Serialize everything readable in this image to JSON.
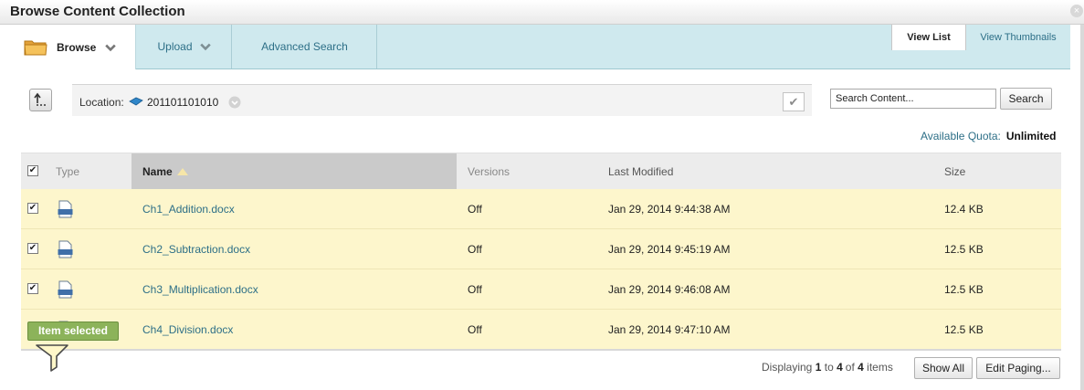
{
  "window": {
    "title": "Browse Content Collection",
    "close_glyph": "×"
  },
  "tabs": {
    "browse": "Browse",
    "upload": "Upload",
    "advanced_search": "Advanced Search",
    "view_list": "View List",
    "view_thumbnails": "View Thumbnails"
  },
  "location": {
    "label": "Location:",
    "value": "201101101010",
    "check_glyph": "✔"
  },
  "search": {
    "placeholder": "Search Content...",
    "value": "Search Content...",
    "button": "Search"
  },
  "quota": {
    "label": "Available Quota:",
    "value": "Unlimited"
  },
  "table": {
    "headers": {
      "type": "Type",
      "name": "Name",
      "versions": "Versions",
      "last_modified": "Last Modified",
      "size": "Size"
    },
    "rows": [
      {
        "name": "Ch1_Addition.docx",
        "versions": "Off",
        "modified": "Jan 29, 2014 9:44:38 AM",
        "size": "12.4 KB",
        "checked": true
      },
      {
        "name": "Ch2_Subtraction.docx",
        "versions": "Off",
        "modified": "Jan 29, 2014 9:45:19 AM",
        "size": "12.5 KB",
        "checked": true
      },
      {
        "name": "Ch3_Multiplication.docx",
        "versions": "Off",
        "modified": "Jan 29, 2014 9:46:08 AM",
        "size": "12.5 KB",
        "checked": true
      },
      {
        "name": "Ch4_Division.docx",
        "versions": "Off",
        "modified": "Jan 29, 2014 9:47:10 AM",
        "size": "12.5 KB",
        "checked": true
      }
    ],
    "check_glyph": "✔"
  },
  "tooltip": {
    "text": "Item selected"
  },
  "paging": {
    "prefix": "Displaying",
    "from": "1",
    "to_word": "to",
    "to": "4",
    "of_word": "of",
    "total": "4",
    "suffix": "items",
    "show_all": "Show All",
    "edit_paging": "Edit Paging..."
  },
  "colors": {
    "accent_link": "#2d6f87",
    "tab_bar": "#cfe9ee",
    "row_selected": "#fdf6cc",
    "tooltip_green": "#8cb35a"
  },
  "icons": [
    "folder-icon",
    "chevron-down-icon",
    "up-folder-icon",
    "location-folder-icon",
    "dropdown-icon",
    "checkmark-icon",
    "doc-file-icon",
    "sort-ascending-icon",
    "pointer-arrow-icon",
    "close-icon"
  ]
}
